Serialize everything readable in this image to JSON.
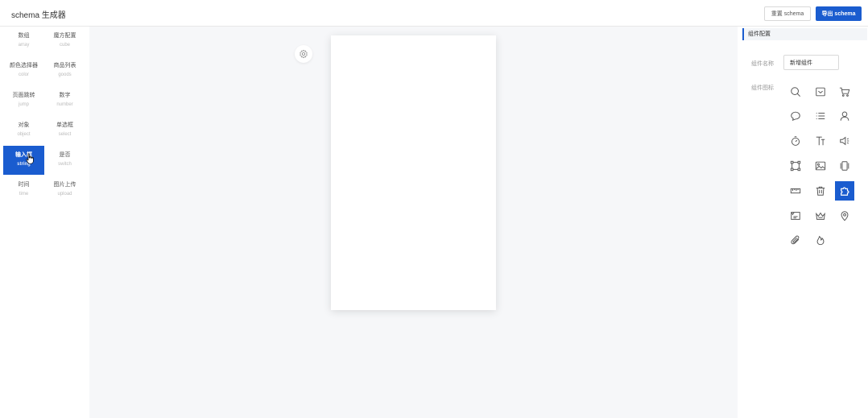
{
  "header": {
    "title": "schema 生成器",
    "reset_label": "重置 schema",
    "export_label": "导出 schema"
  },
  "sidebar": {
    "items": [
      {
        "cn": "数组",
        "en": "array"
      },
      {
        "cn": "魔方配置",
        "en": "cube"
      },
      {
        "cn": "颜色选择器",
        "en": "color"
      },
      {
        "cn": "商品列表",
        "en": "goods"
      },
      {
        "cn": "页面跳转",
        "en": "jump"
      },
      {
        "cn": "数字",
        "en": "number"
      },
      {
        "cn": "对象",
        "en": "object"
      },
      {
        "cn": "单选框",
        "en": "select"
      },
      {
        "cn": "输入框",
        "en": "string",
        "active": true
      },
      {
        "cn": "是否",
        "en": "switch"
      },
      {
        "cn": "时间",
        "en": "time"
      },
      {
        "cn": "图片上传",
        "en": "upload"
      }
    ]
  },
  "panel": {
    "title": "组件配置",
    "name_label": "组件名称",
    "name_value": "新增组件",
    "icon_label": "组件图标",
    "icons": [
      "search-icon",
      "mail-icon",
      "cart-icon",
      "chat-icon",
      "list-icon",
      "user-icon",
      "timer-icon",
      "text-icon",
      "speaker-icon",
      "crop-icon",
      "image-icon",
      "carousel-icon",
      "ruler-icon",
      "delete-icon",
      "puzzle-icon",
      "shop-icon",
      "crown-icon",
      "location-icon",
      "attachment-icon",
      "fire-icon"
    ],
    "selected_icon": "puzzle-icon"
  },
  "colors": {
    "accent": "#1a5ccf",
    "canvas_bg": "#f6f7f9"
  }
}
